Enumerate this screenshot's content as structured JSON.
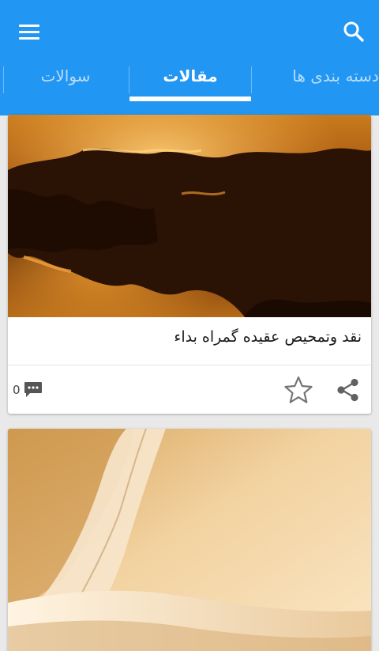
{
  "toolbar": {
    "menu_icon": "hamburger-menu-icon",
    "search_icon": "search-icon",
    "color": "#2196f3"
  },
  "tabs": [
    {
      "label": "دسته بندی ها",
      "active": false
    },
    {
      "label": "مقالات",
      "active": true
    },
    {
      "label": "سوالات",
      "active": false
    }
  ],
  "cards": [
    {
      "image": "sunset-clouds-photo",
      "title": "نقد وتمحیص عقیده گمراه بداء",
      "comment_count": "0",
      "icons": [
        "comment-icon",
        "star-icon",
        "share-icon"
      ]
    },
    {
      "image": "open-book-photo"
    }
  ]
}
